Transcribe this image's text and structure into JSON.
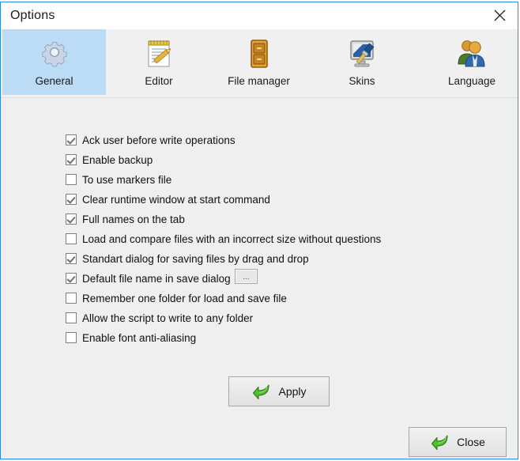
{
  "window": {
    "title": "Options",
    "close_icon": "close-x-icon",
    "border_color": "#2a8ce0",
    "background_color": "#efefef"
  },
  "tabs": {
    "selected": "General",
    "selected_color": "#bcdcf5",
    "items": [
      {
        "label": "General",
        "icon": "gear-icon"
      },
      {
        "label": "Editor",
        "icon": "notepad-pencil-icon"
      },
      {
        "label": "File manager",
        "icon": "file-cabinet-icon"
      },
      {
        "label": "Skins",
        "icon": "monitor-paintbrush-icon"
      },
      {
        "label": "Language",
        "icon": "users-icon"
      }
    ]
  },
  "options": {
    "checkboxes": [
      {
        "label": "Ack user before write operations",
        "checked": true
      },
      {
        "label": "Enable backup",
        "checked": true
      },
      {
        "label": "To use markers file",
        "checked": false
      },
      {
        "label": "Clear runtime window at start command",
        "checked": true
      },
      {
        "label": "Full names on the tab",
        "checked": true
      },
      {
        "label": "Load and compare files with an incorrect size without questions",
        "checked": false
      },
      {
        "label": "Standart dialog for saving files by drag and drop",
        "checked": true
      },
      {
        "label": "Default file name in save dialog",
        "checked": true
      },
      {
        "label": "Remember one folder for load and save file",
        "checked": false
      },
      {
        "label": "Allow the script to write to any folder",
        "checked": false
      },
      {
        "label": "Enable font anti-aliasing",
        "checked": false
      }
    ],
    "browse_button_label": "..."
  },
  "buttons": {
    "apply": {
      "label": "Apply",
      "icon": "green-arrow-icon"
    },
    "close": {
      "label": "Close",
      "icon": "green-arrow-icon"
    }
  }
}
